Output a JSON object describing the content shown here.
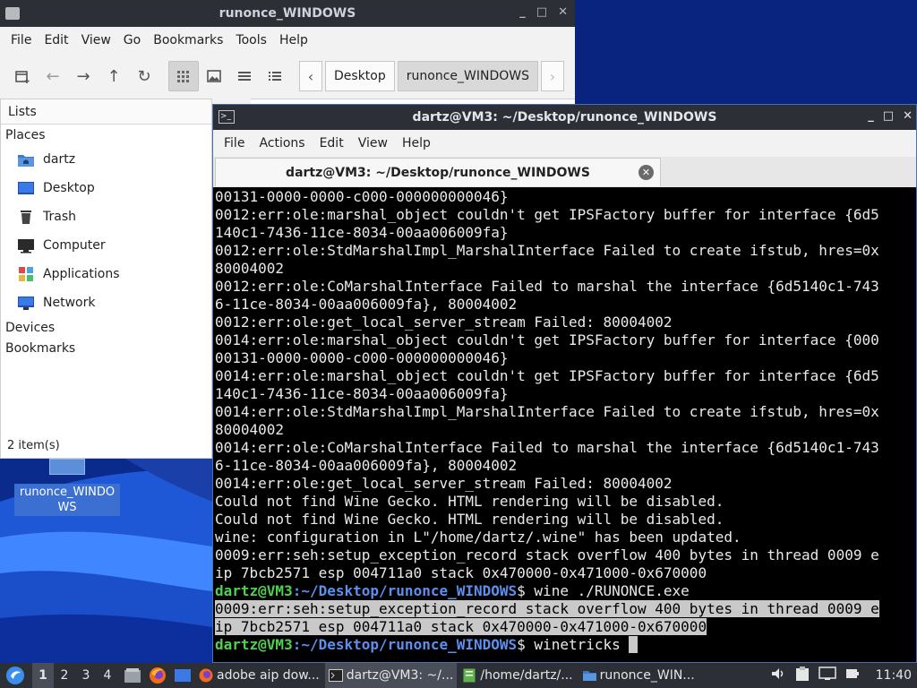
{
  "colors": {
    "titlebar": "#2c2f36",
    "terminal_bg": "#000000",
    "prompt_user": "#4fd14f",
    "prompt_path": "#5b8ff0",
    "selection": "#c9c9c9",
    "desktop_blue": "#0a2a8c"
  },
  "desktop": {
    "icon_label": "runonce_WINDOWS"
  },
  "file_manager": {
    "title": "runonce_WINDOWS",
    "menu": [
      "File",
      "Edit",
      "View",
      "Go",
      "Bookmarks",
      "Tools",
      "Help"
    ],
    "breadcrumb": [
      "Desktop",
      "runonce_WINDOWS"
    ],
    "side_mode": "Lists",
    "places_header": "Places",
    "places": [
      {
        "label": "dartz",
        "icon": "home-folder-icon"
      },
      {
        "label": "Desktop",
        "icon": "desktop-icon"
      },
      {
        "label": "Trash",
        "icon": "trash-icon"
      },
      {
        "label": "Computer",
        "icon": "computer-icon"
      },
      {
        "label": "Applications",
        "icon": "applications-icon"
      },
      {
        "label": "Network",
        "icon": "network-icon"
      }
    ],
    "devices_header": "Devices",
    "bookmarks_header": "Bookmarks",
    "status": "2 item(s)"
  },
  "terminal": {
    "title": "dartz@VM3: ~/Desktop/runonce_WINDOWS",
    "menu": [
      "File",
      "Actions",
      "Edit",
      "View",
      "Help"
    ],
    "tab_title": "dartz@VM3: ~/Desktop/runonce_WINDOWS",
    "prompt_user": "dartz@VM3",
    "prompt_path": ":~/Desktop/runonce_WINDOWS",
    "prompt_sym": "$ ",
    "lines": [
      {
        "t": "00131-0000-0000-c000-000000000046}"
      },
      {
        "t": "0012:err:ole:marshal_object couldn't get IPSFactory buffer for interface {6d5"
      },
      {
        "t": "140c1-7436-11ce-8034-00aa006009fa}"
      },
      {
        "t": "0012:err:ole:StdMarshalImpl_MarshalInterface Failed to create ifstub, hres=0x"
      },
      {
        "t": "80004002"
      },
      {
        "t": "0012:err:ole:CoMarshalInterface Failed to marshal the interface {6d5140c1-743"
      },
      {
        "t": "6-11ce-8034-00aa006009fa}, 80004002"
      },
      {
        "t": "0012:err:ole:get_local_server_stream Failed: 80004002"
      },
      {
        "t": "0014:err:ole:marshal_object couldn't get IPSFactory buffer for interface {000"
      },
      {
        "t": "00131-0000-0000-c000-000000000046}"
      },
      {
        "t": "0014:err:ole:marshal_object couldn't get IPSFactory buffer for interface {6d5"
      },
      {
        "t": "140c1-7436-11ce-8034-00aa006009fa}"
      },
      {
        "t": "0014:err:ole:StdMarshalImpl_MarshalInterface Failed to create ifstub, hres=0x"
      },
      {
        "t": "80004002"
      },
      {
        "t": "0014:err:ole:CoMarshalInterface Failed to marshal the interface {6d5140c1-743"
      },
      {
        "t": "6-11ce-8034-00aa006009fa}, 80004002"
      },
      {
        "t": "0014:err:ole:get_local_server_stream Failed: 80004002"
      },
      {
        "t": "Could not find Wine Gecko. HTML rendering will be disabled."
      },
      {
        "t": "Could not find Wine Gecko. HTML rendering will be disabled."
      },
      {
        "t": "wine: configuration in L\"/home/dartz/.wine\" has been updated."
      },
      {
        "t": "0009:err:seh:setup_exception_record stack overflow 400 bytes in thread 0009 e"
      },
      {
        "t": "ip 7bcb2571 esp 004711a0 stack 0x470000-0x471000-0x670000"
      },
      {
        "prompt": true,
        "t": "wine ./RUNONCE.exe"
      },
      {
        "t": "0009:err:seh:setup_exception_record stack overflow 400 bytes in thread 0009 e",
        "hl": true
      },
      {
        "t": "ip 7bcb2571 esp 004711a0 stack 0x470000-0x471000-0x670000",
        "hl": true
      },
      {
        "prompt": true,
        "t": "winetricks",
        "cursor": true
      }
    ]
  },
  "taskbar": {
    "workspaces": [
      "1",
      "2",
      "3",
      "4"
    ],
    "active_workspace": "1",
    "tasks": [
      {
        "label": "adobe aip dow...",
        "icon": "firefox-icon"
      },
      {
        "label": "dartz@VM3: ~/...",
        "icon": "terminal-icon",
        "active": true
      },
      {
        "label": "/home/dartz/...",
        "icon": "text-editor-icon"
      },
      {
        "label": "runonce_WIN...",
        "icon": "folder-icon"
      }
    ],
    "clock": "11:40"
  }
}
